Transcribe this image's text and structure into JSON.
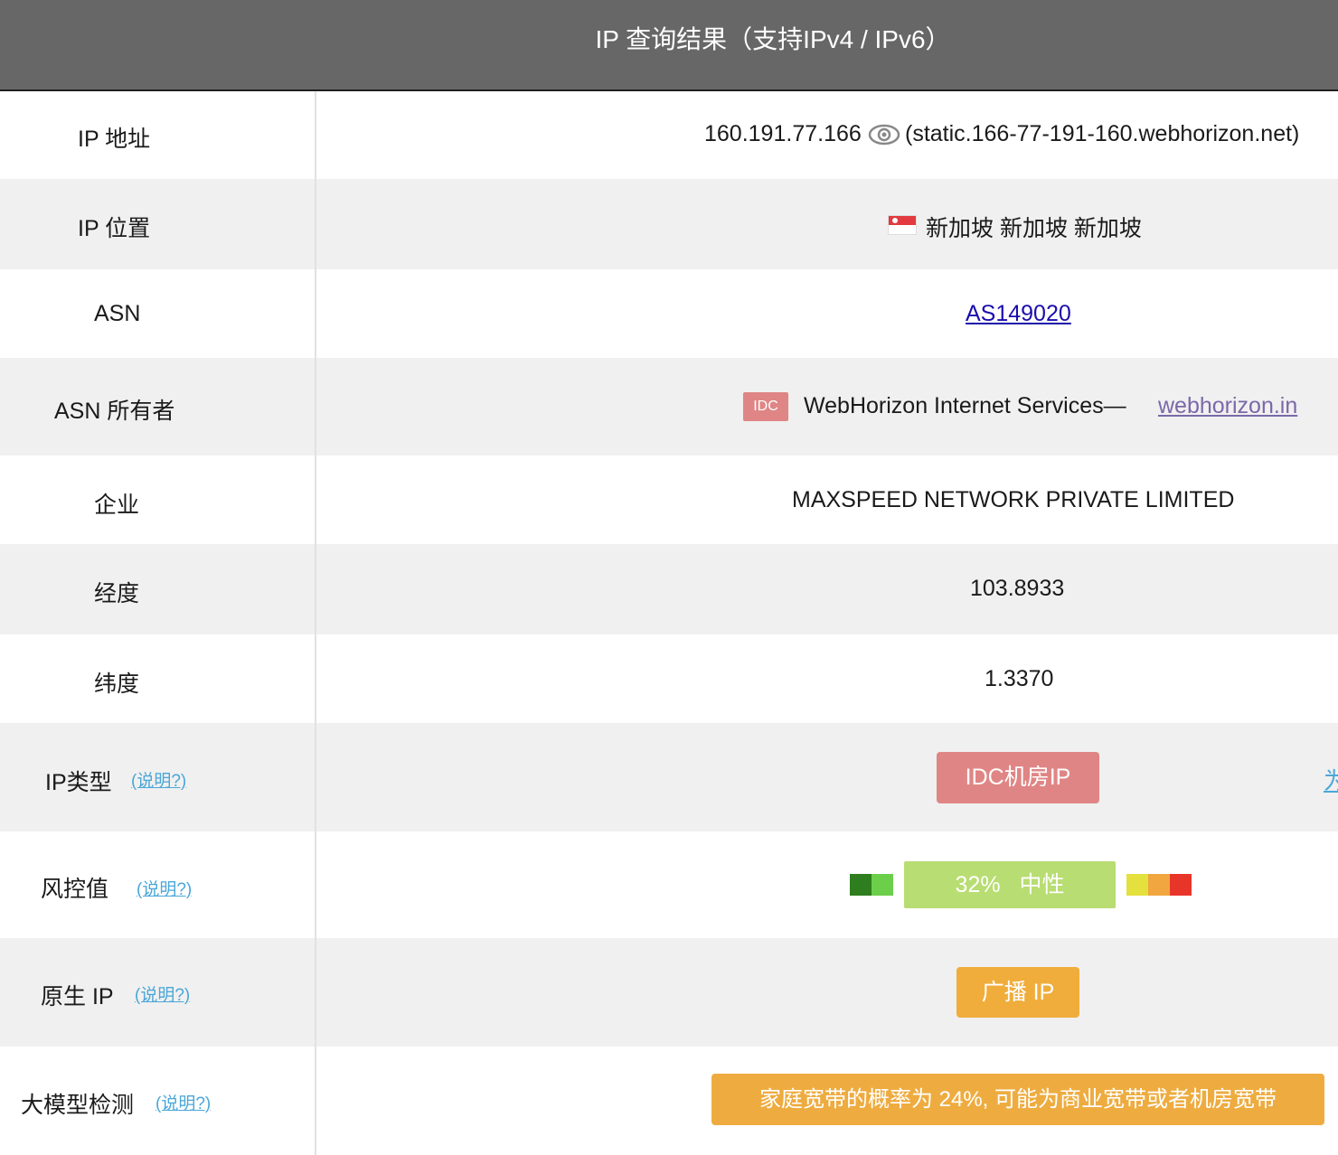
{
  "header": {
    "title": "IP 查询结果（支持IPv4 / IPv6）"
  },
  "rows": {
    "ip": {
      "label": "IP 地址",
      "address": "160.191.77.166",
      "hostname": "(static.166-77-191-160.webhorizon.net)",
      "icon": "eye-icon"
    },
    "location": {
      "label": "IP 位置",
      "flag": "singapore-flag-icon",
      "value": "新加坡 新加坡 新加坡"
    },
    "asn": {
      "label": "ASN",
      "value": "AS149020"
    },
    "asn_owner": {
      "label": "ASN 所有者",
      "badge": "IDC",
      "name": "WebHorizon Internet Services—",
      "site": "webhorizon.in"
    },
    "company": {
      "label": "企业",
      "value": "MAXSPEED NETWORK PRIVATE LIMITED"
    },
    "longitude": {
      "label": "经度",
      "value": "103.8933"
    },
    "latitude": {
      "label": "纬度",
      "value": "1.3370"
    },
    "ip_type": {
      "label": "IP类型",
      "explain": "(说明?)",
      "value": "IDC机房IP",
      "edge_link": "为"
    },
    "risk": {
      "label": "风控值",
      "explain": "(说明?)",
      "score": "32%",
      "level": "中性",
      "score_percent": 32
    },
    "native": {
      "label": "原生 IP",
      "explain": "(说明?)",
      "value": "广播 IP"
    },
    "llm": {
      "label": "大模型检测",
      "explain": "(说明?)",
      "value": "家庭宽带的概率为 24%, 可能为商业宽带或者机房宽带"
    }
  },
  "colors": {
    "header_bg": "#676767",
    "row_gray": "#f0f0f0",
    "idc_red": "#e08585",
    "score_green": "#b8dd72",
    "native_orange": "#f0ad3b",
    "link_blue": "#1a0dab",
    "explain_blue": "#4aa7d8"
  }
}
